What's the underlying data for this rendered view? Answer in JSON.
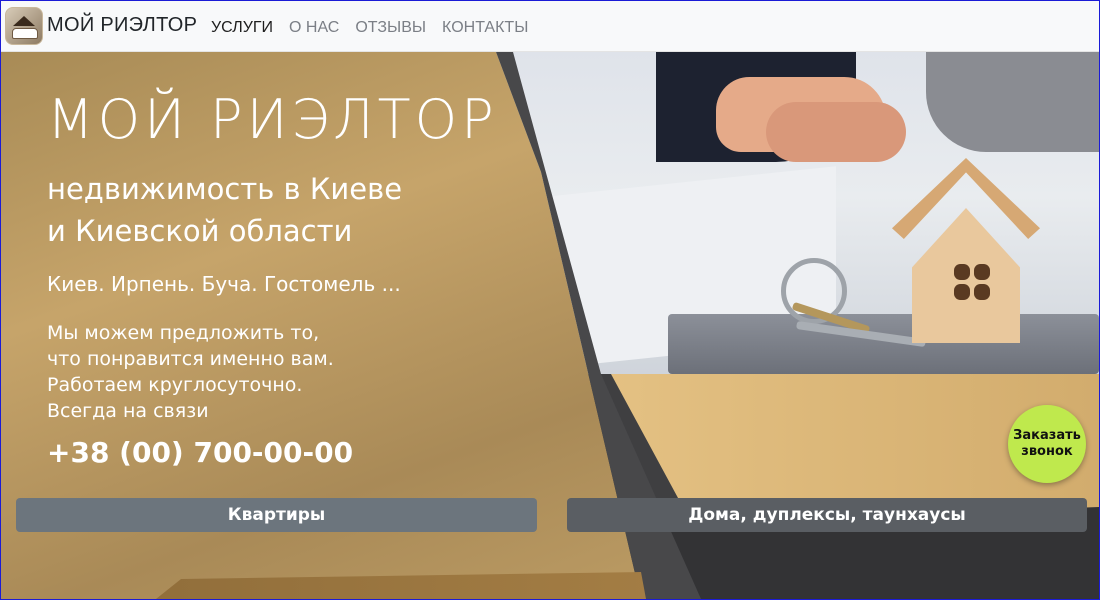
{
  "navbar": {
    "brand": "МОЙ РИЭЛТОР",
    "items": [
      {
        "label": "УСЛУГИ",
        "active": true
      },
      {
        "label": "О НАС",
        "active": false
      },
      {
        "label": "ОТЗЫВЫ",
        "active": false
      },
      {
        "label": "КОНТАКТЫ",
        "active": false
      }
    ]
  },
  "hero": {
    "title": "МОЙ РИЭЛТОР",
    "subtitle_line1": "недвижимость в Киеве",
    "subtitle_line2": "и Киевской области",
    "cities": "Киев. Ирпень. Буча. Гостомель ...",
    "desc_lines": [
      "Мы можем предложить то,",
      "что понравится именно вам.",
      "Работаем круглосуточно.",
      "Всегда на связи"
    ],
    "phone": "+38 (00) 700-00-00"
  },
  "buttons": {
    "apartments": "Квартиры",
    "houses": "Дома, дуплексы, таунхаусы"
  },
  "callback": {
    "line1": "Заказать",
    "line2": "звонок"
  },
  "colors": {
    "accent_callback": "#bfe94d",
    "button_primary": "#6c757d",
    "gold": "#c6a46a"
  }
}
